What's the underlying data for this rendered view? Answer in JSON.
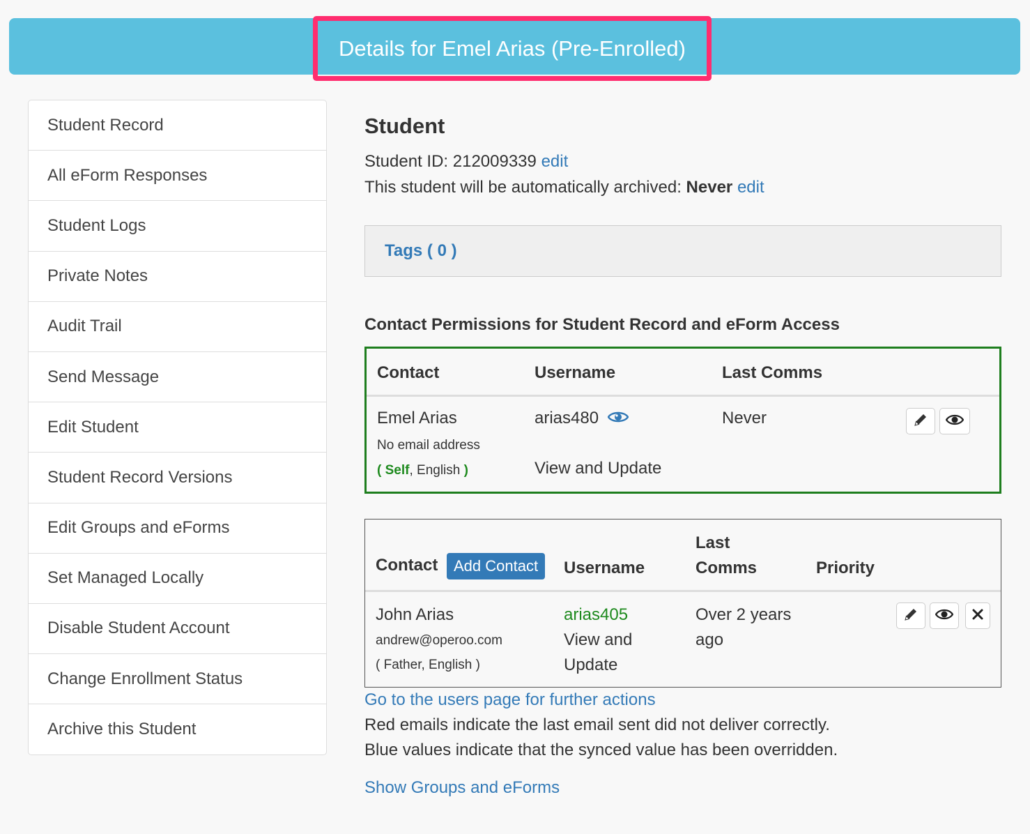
{
  "header": {
    "title": "Details for Emel Arias (Pre-Enrolled)"
  },
  "colors": {
    "header_bg": "#5bc0de",
    "highlight_border": "#ff2d6f",
    "link": "#337ab7",
    "green": "#1e8a1e",
    "button_bg": "#337ab7"
  },
  "sidebar": {
    "items": [
      {
        "label": "Student Record"
      },
      {
        "label": "All eForm Responses"
      },
      {
        "label": "Student Logs"
      },
      {
        "label": "Private Notes"
      },
      {
        "label": "Audit Trail"
      },
      {
        "label": "Send Message"
      },
      {
        "label": "Edit Student"
      },
      {
        "label": "Student Record Versions"
      },
      {
        "label": "Edit Groups and eForms"
      },
      {
        "label": "Set Managed Locally"
      },
      {
        "label": "Disable Student Account"
      },
      {
        "label": "Change Enrollment Status"
      },
      {
        "label": "Archive this Student"
      }
    ]
  },
  "student": {
    "heading": "Student",
    "id_label": "Student ID:",
    "id_value": "212009339",
    "edit_label": "edit",
    "archive_text": "This student will be automatically archived:",
    "archive_value": "Never",
    "archive_edit_label": "edit"
  },
  "tags": {
    "label": "Tags ( 0 )"
  },
  "permissions": {
    "title": "Contact Permissions for Student Record and eForm Access",
    "columns": {
      "contact": "Contact",
      "username": "Username",
      "last_comms": "Last Comms"
    },
    "row": {
      "name": "Emel Arias",
      "email": "No email address",
      "paren_open": "(",
      "relation": "Self",
      "sep": ",",
      "language": "English",
      "paren_close": ")",
      "username": "arias480",
      "access": "View and Update",
      "last_comms": "Never"
    },
    "icons": [
      "pencil-icon",
      "eye-icon"
    ]
  },
  "contacts": {
    "columns": {
      "contact": "Contact",
      "add_button": "Add Contact",
      "username": "Username",
      "last_comms_1": "Last",
      "last_comms_2": "Comms",
      "priority": "Priority"
    },
    "row": {
      "name": "John Arias",
      "email": "andrew@operoo.com",
      "paren_open": "(",
      "relation": "Father",
      "sep": ",",
      "language": "English",
      "paren_close": ")",
      "username": "arias405",
      "access_1": "View and",
      "access_2": "Update",
      "last_comms_1": "Over 2 years",
      "last_comms_2": "ago"
    },
    "icons": [
      "pencil-icon",
      "eye-icon",
      "close-icon"
    ]
  },
  "footer": {
    "users_link": "Go to the users page for further actions",
    "note_red": "Red emails indicate the last email sent did not deliver correctly.",
    "note_blue": "Blue values indicate that the synced value has been overridden.",
    "show_groups_link": "Show Groups and eForms"
  }
}
